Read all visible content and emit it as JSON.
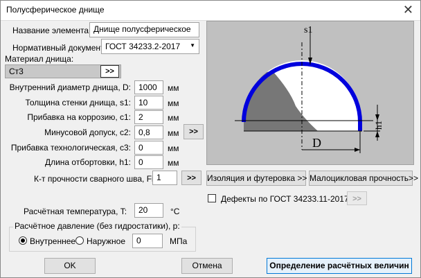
{
  "window": {
    "title": "Полусферическое днище",
    "close_glyph": "✕"
  },
  "form": {
    "element_name_label": "Название элемента:",
    "element_name_value": "Днище полусферическое",
    "norm_doc_label": "Нормативный документ:",
    "norm_doc_value": "ГОСТ 34233.2-2017",
    "material_label": "Материал днища:",
    "material_value": "Ст3",
    "material_button": ">>",
    "fields": [
      {
        "label": "Внутренний диаметр днища, D:",
        "value": "1000",
        "unit": "мм"
      },
      {
        "label": "Толщина стенки днища, s1:",
        "value": "10",
        "unit": "мм"
      },
      {
        "label": "Прибавка на коррозию, c1:",
        "value": "2",
        "unit": "мм"
      },
      {
        "label": "Минусовой допуск, c2:",
        "value": "0,8",
        "unit": "мм"
      },
      {
        "label": "Прибавка технологическая, c3:",
        "value": "0",
        "unit": "мм"
      },
      {
        "label": "Длина отбортовки, h1:",
        "value": "0",
        "unit": "мм"
      }
    ],
    "tolerance_button": ">>",
    "weld_label": "К-т прочности сварного шва, Fi:",
    "weld_value": "1",
    "weld_button": ">>",
    "temp_label": "Расчётная температура, T:",
    "temp_value": "20",
    "temp_unit": "°C",
    "pressure_group_label": "Расчётное давление (без гидростатики), p:",
    "pressure_inner_label": "Внутреннее",
    "pressure_outer_label": "Наружное",
    "pressure_value": "0",
    "pressure_unit": "МПа",
    "pressure_selected": "inner"
  },
  "diagram": {
    "label_s1": "s1",
    "label_h1": "h1",
    "label_D": "D",
    "colors": {
      "background": "#c0c0c0",
      "shell": "#0000dd",
      "hatch": "#777777"
    }
  },
  "buttons": {
    "insulation": "Изоляция и футеровка >>",
    "lowcycle": "Малоцикловая прочность>>",
    "defects_label": "Дефекты по ГОСТ 34233.11-2017",
    "defects_button": ">>",
    "ok": "OK",
    "cancel": "Отмена",
    "calc": "Определение расчётных величин"
  }
}
